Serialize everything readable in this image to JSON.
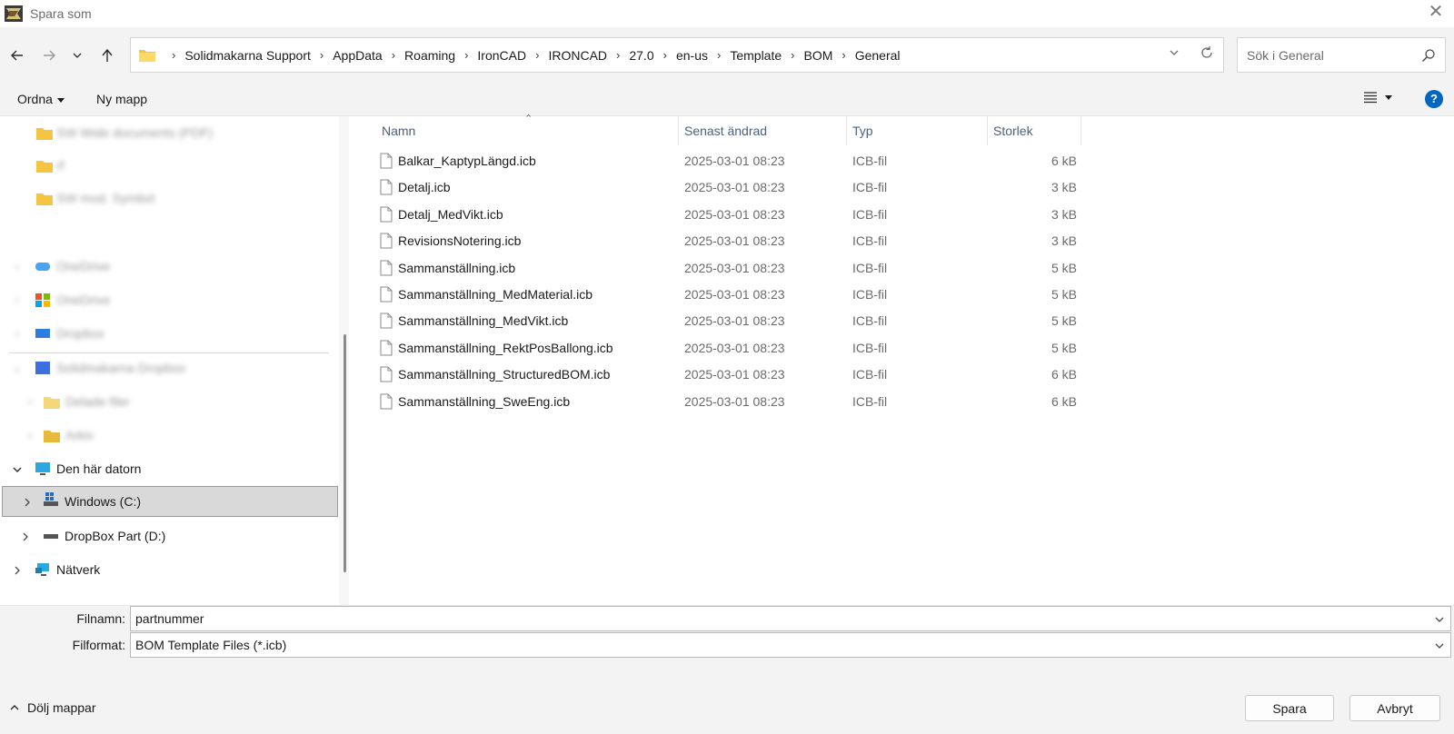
{
  "window": {
    "title": "Spara som"
  },
  "address": {
    "breadcrumbs": [
      "Solidmakarna Support",
      "AppData",
      "Roaming",
      "IronCAD",
      "IRONCAD",
      "27.0",
      "en-us",
      "Template",
      "BOM",
      "General"
    ]
  },
  "search": {
    "placeholder": "Sök i General"
  },
  "commandbar": {
    "organize": "Ordna",
    "new_folder": "Ny mapp",
    "help": "?"
  },
  "navpane": {
    "quick_blurred": [
      "SW Wide documents (PDF)",
      "rf",
      "SW mod. Symbol"
    ],
    "cloud_blurred": [
      "OneDrive",
      "OneDrive",
      "Dropbox",
      "Solidmakarna Dropbox",
      "Delade filer",
      "Arkiv"
    ],
    "this_pc": "Den här datorn",
    "drives": [
      {
        "label": "Windows  (C:)",
        "selected": true
      },
      {
        "label": "DropBox Part (D:)",
        "selected": false
      }
    ],
    "network": "Nätverk"
  },
  "filelist": {
    "columns": {
      "name": "Namn",
      "modified": "Senast ändrad",
      "type": "Typ",
      "size": "Storlek"
    },
    "rows": [
      {
        "name": "Balkar_KaptypLängd.icb",
        "modified": "2025-03-01 08:23",
        "type": "ICB-fil",
        "size": "6 kB"
      },
      {
        "name": "Detalj.icb",
        "modified": "2025-03-01 08:23",
        "type": "ICB-fil",
        "size": "3 kB"
      },
      {
        "name": "Detalj_MedVikt.icb",
        "modified": "2025-03-01 08:23",
        "type": "ICB-fil",
        "size": "3 kB"
      },
      {
        "name": "RevisionsNotering.icb",
        "modified": "2025-03-01 08:23",
        "type": "ICB-fil",
        "size": "3 kB"
      },
      {
        "name": "Sammanställning.icb",
        "modified": "2025-03-01 08:23",
        "type": "ICB-fil",
        "size": "5 kB"
      },
      {
        "name": "Sammanställning_MedMaterial.icb",
        "modified": "2025-03-01 08:23",
        "type": "ICB-fil",
        "size": "5 kB"
      },
      {
        "name": "Sammanställning_MedVikt.icb",
        "modified": "2025-03-01 08:23",
        "type": "ICB-fil",
        "size": "5 kB"
      },
      {
        "name": "Sammanställning_RektPosBallong.icb",
        "modified": "2025-03-01 08:23",
        "type": "ICB-fil",
        "size": "5 kB"
      },
      {
        "name": "Sammanställning_StructuredBOM.icb",
        "modified": "2025-03-01 08:23",
        "type": "ICB-fil",
        "size": "6 kB"
      },
      {
        "name": "Sammanställning_SweEng.icb",
        "modified": "2025-03-01 08:23",
        "type": "ICB-fil",
        "size": "6 kB"
      }
    ]
  },
  "form": {
    "filename_label": "Filnamn:",
    "filename_value": "partnummer",
    "format_label": "Filformat:",
    "format_value": "BOM Template Files (*.icb)",
    "hide_folders": "Dölj mappar",
    "save": "Spara",
    "cancel": "Avbryt"
  },
  "colors": {
    "accent": "#0067c0",
    "selected_bg": "#d9d9d9",
    "header_text": "#4c607a"
  }
}
